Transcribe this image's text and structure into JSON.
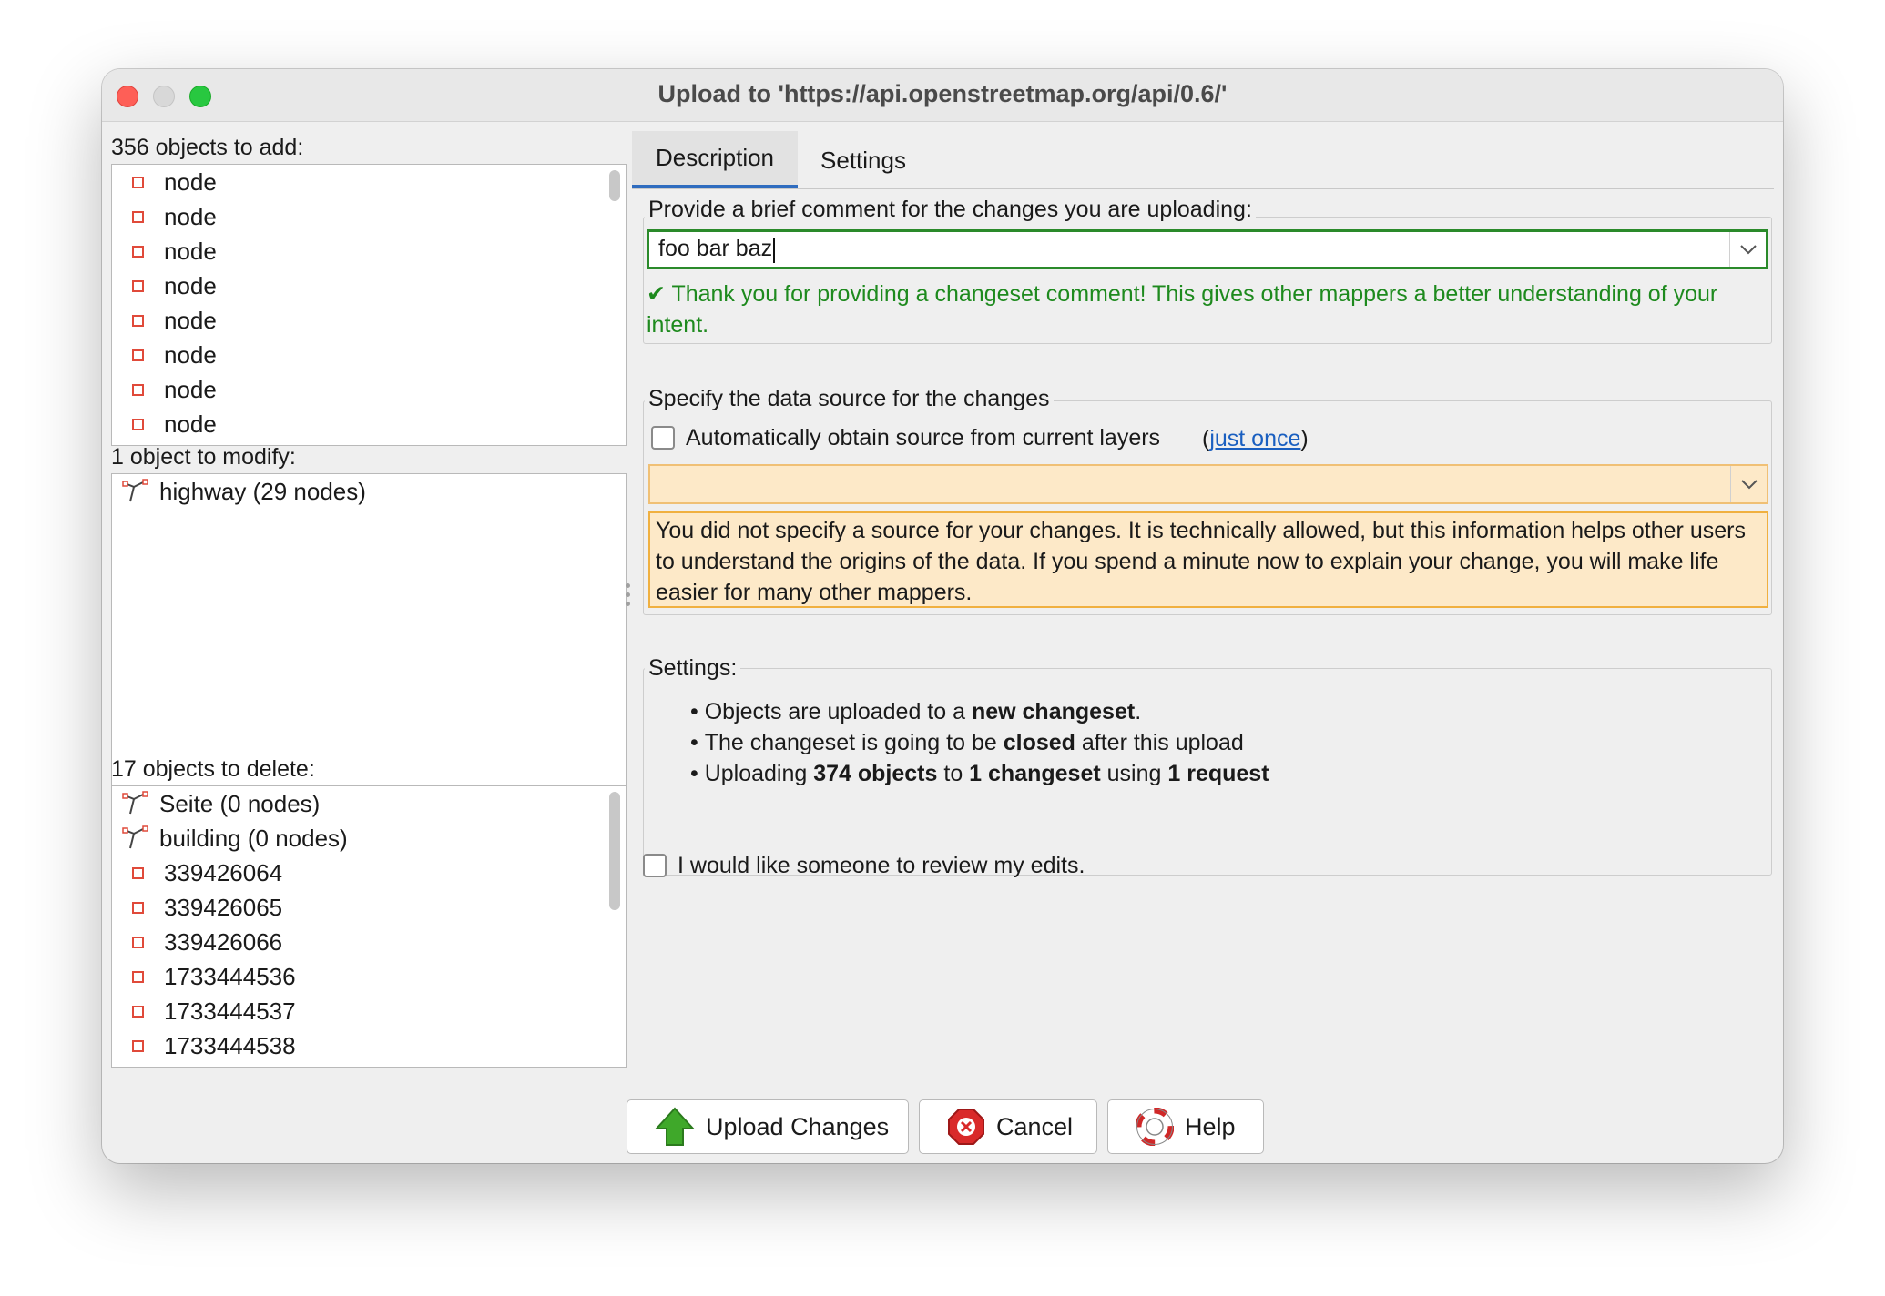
{
  "window": {
    "title": "Upload to 'https://api.openstreetmap.org/api/0.6/'"
  },
  "left": {
    "add": {
      "label": "356 objects to add:",
      "items": [
        "node",
        "node",
        "node",
        "node",
        "node",
        "node",
        "node",
        "node"
      ]
    },
    "modify": {
      "label": "1 object to modify:",
      "items": [
        "highway (29 nodes)"
      ]
    },
    "delete": {
      "label": "17 objects to delete:",
      "ways": [
        "Seite (0 nodes)",
        "building (0 nodes)"
      ],
      "nodes": [
        "339426064",
        "339426065",
        "339426066",
        "1733444536",
        "1733444537",
        "1733444538"
      ]
    }
  },
  "tabs": [
    {
      "label": "Description"
    },
    {
      "label": "Settings"
    }
  ],
  "comment": {
    "prompt": "Provide a brief comment for the changes you are uploading:",
    "value": "foo bar baz",
    "thanks": "✔ Thank you for providing a changeset comment! This gives other mappers a better understanding of your intent."
  },
  "source": {
    "title": "Specify the data source for the changes",
    "auto_label": "Automatically obtain source from current layers",
    "paren_open": "(",
    "just_once": "just once",
    "paren_close": ")",
    "value": "",
    "warning": "You did not specify a source for your changes. It is technically allowed, but this information helps other users to understand the origins of the data. If you spend a minute now to explain your change, you will make life easier for many other mappers."
  },
  "settings": {
    "title": "Settings:",
    "line1": {
      "pre": "Objects are uploaded to a ",
      "bold": "new changeset",
      "post": "."
    },
    "line2": {
      "pre": "The changeset is going to be ",
      "bold": "closed",
      "post": " after this upload"
    },
    "line3": {
      "pre": "Uploading ",
      "bold1": "374 objects",
      "mid1": " to ",
      "bold2": "1 changeset",
      "mid2": " using ",
      "bold3": "1 request"
    }
  },
  "review": {
    "label": "I would like someone to review my edits."
  },
  "buttons": {
    "upload": "Upload Changes",
    "cancel": "Cancel",
    "help": "Help"
  },
  "colors": {
    "accent": "#2f6cbf",
    "success": "#1e8a1e",
    "warning_bg": "#fde9c8",
    "warning_border": "#f0b040",
    "node_icon": "#e04a3a"
  }
}
